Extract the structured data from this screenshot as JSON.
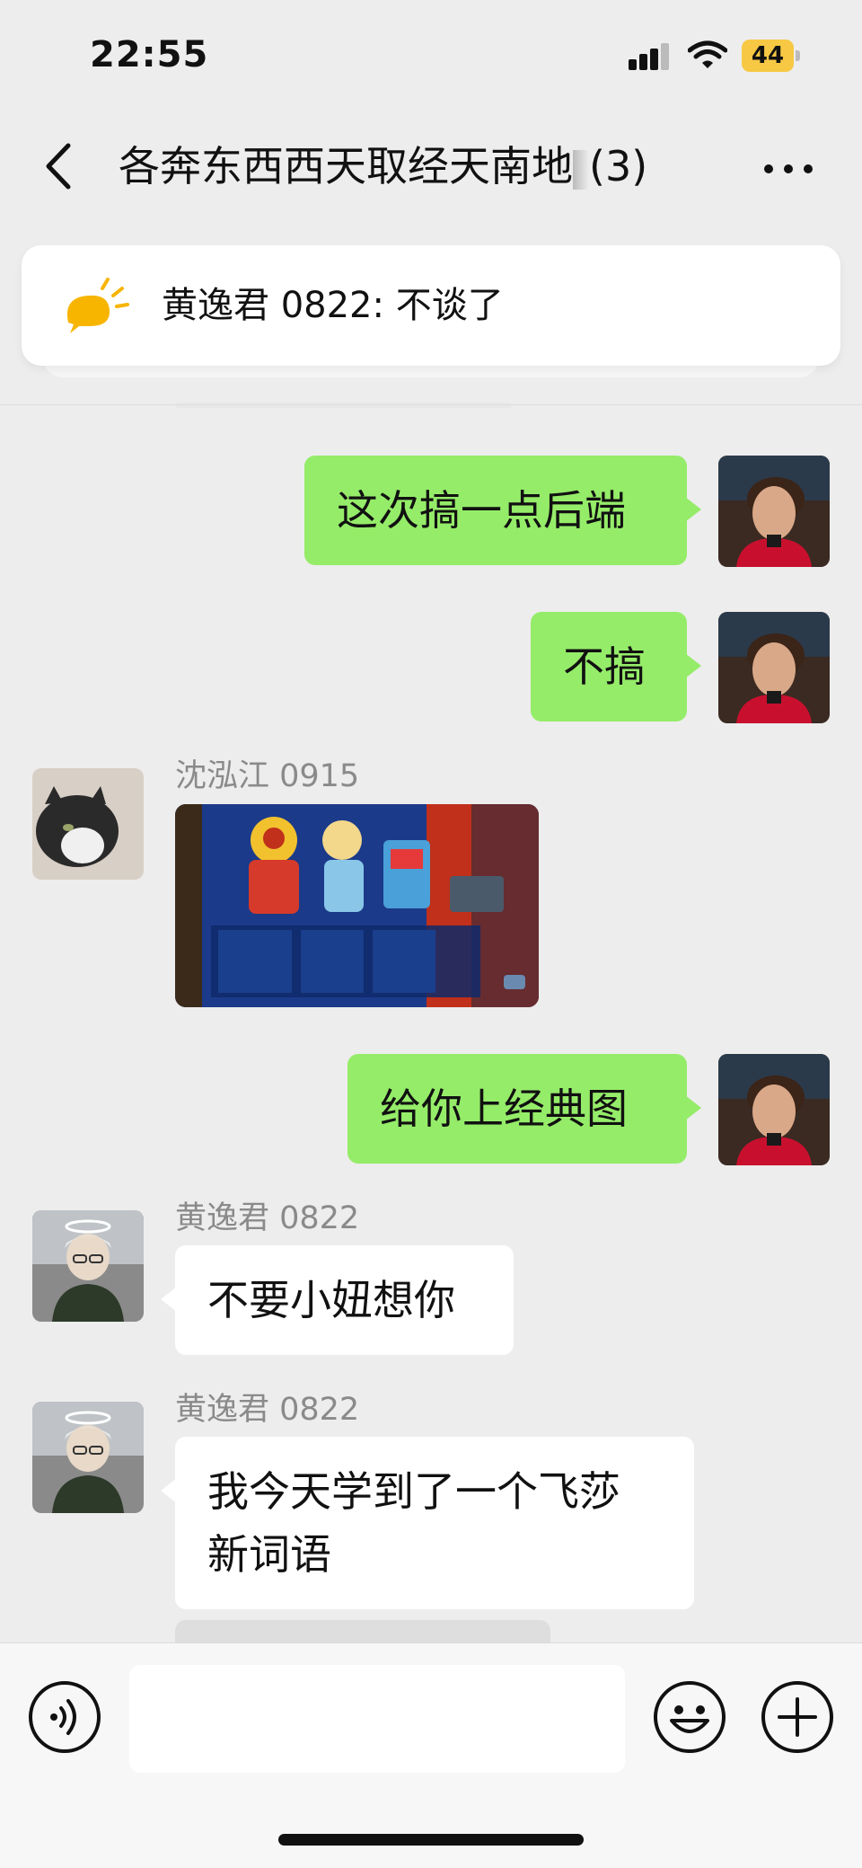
{
  "status_bar": {
    "time": "22:55",
    "battery": "44",
    "icons": [
      "signal-icon",
      "wifi-icon",
      "battery-icon"
    ]
  },
  "header": {
    "title": "各奔东西西天取经天南地北(3)",
    "title_visible": "各奔东西西天取经天南地",
    "title_count": "(3)",
    "back_icon": "chevron-left-icon",
    "more_icon": "more-icon"
  },
  "pinned_notice": {
    "icon": "announcement-icon",
    "text": "黄逸君 0822: 不谈了"
  },
  "messages": [
    {
      "from": "me",
      "type": "text",
      "text": "这次搞一点后端"
    },
    {
      "from": "me",
      "type": "text",
      "text": "不搞"
    },
    {
      "from": "other",
      "sender": "沈泓江 0915",
      "type": "image",
      "image": "game-screenshot"
    },
    {
      "from": "me",
      "type": "text",
      "text": "给你上经典图"
    },
    {
      "from": "other",
      "sender": "黄逸君 0822",
      "type": "text",
      "text": "不要小妞想你"
    },
    {
      "from": "other",
      "sender": "黄逸君 0822",
      "type": "text",
      "text": "我今天学到了一个飞莎新词语",
      "lines": [
        "我今天学到了一个飞莎",
        "新词语"
      ]
    }
  ],
  "input_bar": {
    "voice_icon": "voice-icon",
    "emoji_icon": "emoji-icon",
    "add_icon": "plus-icon",
    "input_value": ""
  },
  "colors": {
    "background": "#ededed",
    "my_bubble": "#95ec69",
    "other_bubble": "#ffffff",
    "battery": "#f7c843"
  }
}
